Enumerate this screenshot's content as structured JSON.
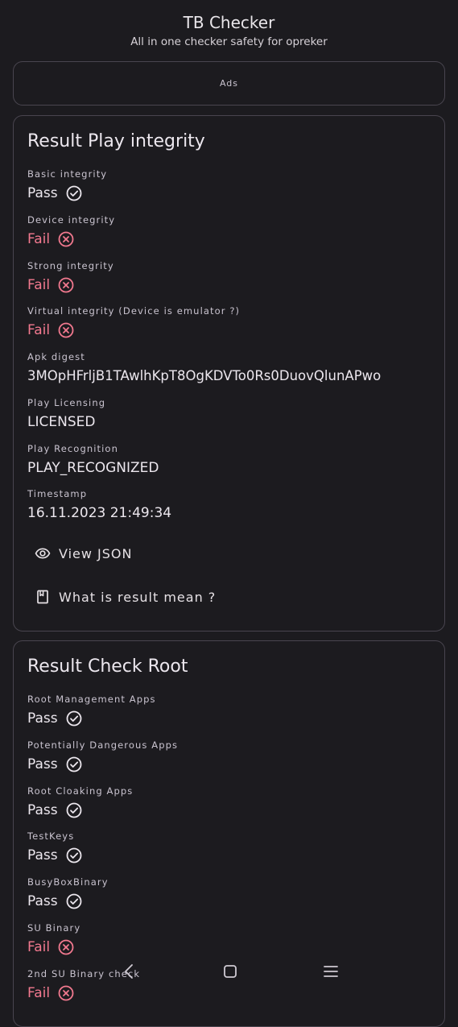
{
  "header": {
    "title": "TB Checker",
    "subtitle": "All in one checker safety for opreker"
  },
  "ads": {
    "label": "Ads"
  },
  "play_integrity": {
    "title": "Result Play integrity",
    "fields": [
      {
        "label": "Basic integrity",
        "value": "Pass",
        "status": "pass"
      },
      {
        "label": "Device integrity",
        "value": "Fail",
        "status": "fail"
      },
      {
        "label": "Strong integrity",
        "value": "Fail",
        "status": "fail"
      },
      {
        "label": "Virtual integrity (Device is emulator ?)",
        "value": "Fail",
        "status": "fail"
      },
      {
        "label": "Apk digest",
        "value": "3MOpHFrljB1TAwlhKpT8OgKDVTo0Rs0DuovQlunAPwo"
      },
      {
        "label": "Play Licensing",
        "value": "LICENSED"
      },
      {
        "label": "Play Recognition",
        "value": "PLAY_RECOGNIZED"
      },
      {
        "label": "Timestamp",
        "value": "16.11.2023 21:49:34"
      }
    ],
    "actions": {
      "view_json": "View JSON",
      "what_mean": "What is result mean ?"
    }
  },
  "root_check": {
    "title": "Result Check Root",
    "fields": [
      {
        "label": "Root Management Apps",
        "value": "Pass",
        "status": "pass"
      },
      {
        "label": "Potentially Dangerous Apps",
        "value": "Pass",
        "status": "pass"
      },
      {
        "label": "Root Cloaking Apps",
        "value": "Pass",
        "status": "pass"
      },
      {
        "label": "TestKeys",
        "value": "Pass",
        "status": "pass"
      },
      {
        "label": "BusyBoxBinary",
        "value": "Pass",
        "status": "pass"
      },
      {
        "label": "SU Binary",
        "value": "Fail",
        "status": "fail"
      },
      {
        "label": "2nd SU Binary check",
        "value": "Fail",
        "status": "fail"
      }
    ]
  },
  "colors": {
    "background": "#1c1b1f",
    "pass": "#ece7ee",
    "fail": "#f2798f",
    "border": "#49454f"
  },
  "icons": {
    "pass": "check-circle-icon",
    "fail": "close-circle-icon",
    "view_json": "eye-icon",
    "what_mean": "book-icon",
    "nav_back": "back-chevron-icon",
    "nav_home": "home-square-icon",
    "nav_menu": "menu-icon"
  }
}
